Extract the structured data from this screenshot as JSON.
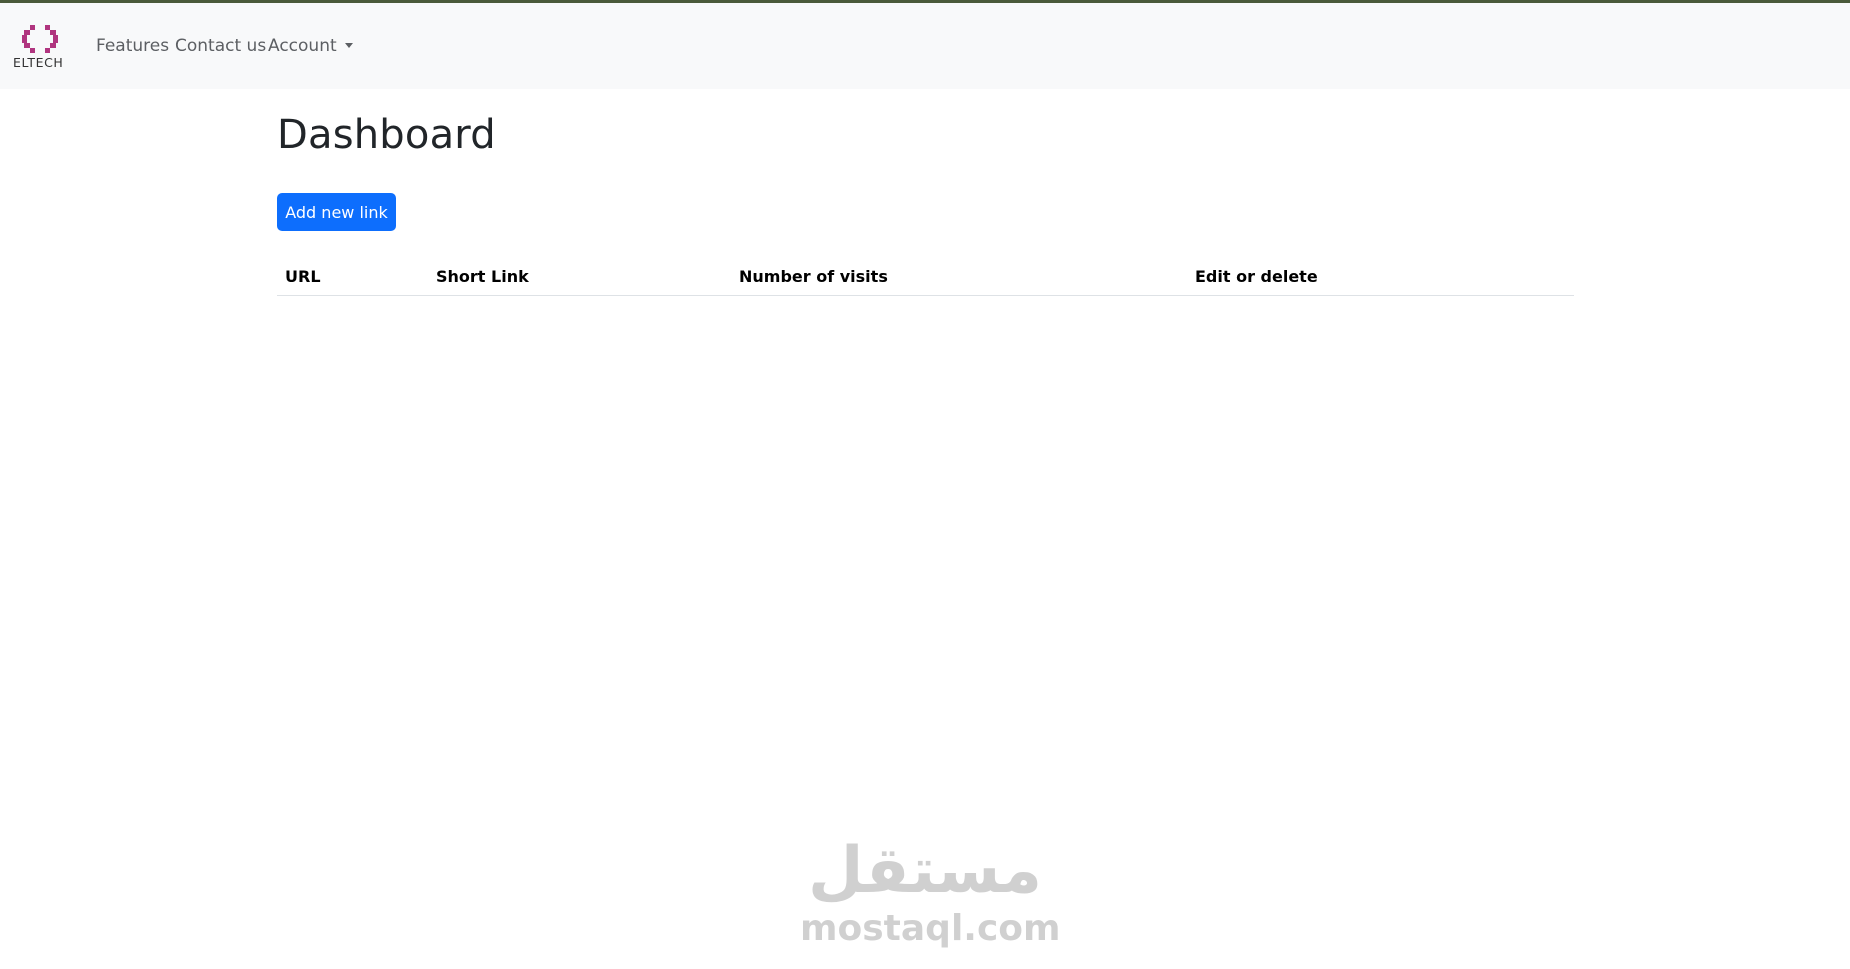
{
  "navbar": {
    "brand": {
      "text": "ELTECH",
      "logo_icon": "eltech-logo-icon",
      "logo_color": "#b0357f"
    },
    "links": [
      {
        "label": "Features"
      },
      {
        "label": "Contact us"
      },
      {
        "label": "Account",
        "has_dropdown": true
      }
    ]
  },
  "main": {
    "title": "Dashboard",
    "add_button_label": "Add new link",
    "table": {
      "headers": [
        "URL",
        "Short Link",
        "Number of visits",
        "Edit or delete"
      ],
      "rows": []
    }
  },
  "watermark": {
    "arabic": "مستقل",
    "latin": "mostaql.com"
  },
  "colors": {
    "primary": "#0d6efd",
    "navbar_bg": "#f8f9fa",
    "top_strip": "#4a5a3a"
  }
}
